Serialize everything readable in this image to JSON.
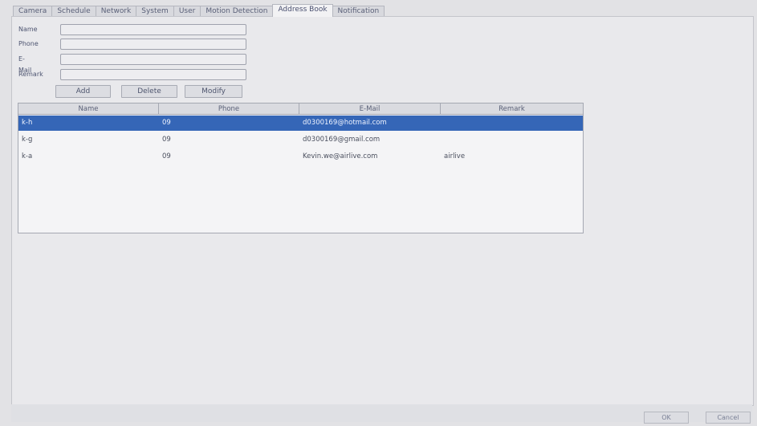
{
  "tabs": [
    "Camera",
    "Schedule",
    "Network",
    "System",
    "User",
    "Motion Detection",
    "Address Book",
    "Notification"
  ],
  "active_tab": "Address Book",
  "form": {
    "name_label": "Name",
    "phone_label": "Phone",
    "email_label": "E-Mail",
    "remark_label": "Remark",
    "name_value": "",
    "phone_value": "",
    "email_value": "",
    "remark_value": ""
  },
  "buttons": {
    "add": "Add",
    "delete": "Delete",
    "modify": "Modify"
  },
  "table": {
    "columns": [
      "Name",
      "Phone",
      "E-Mail",
      "Remark"
    ],
    "rows": [
      {
        "name": "k-h",
        "phone": "09",
        "email": "d0300169@hotmail.com",
        "remark": "",
        "selected": true
      },
      {
        "name": "k-g",
        "phone": "09",
        "email": "d0300169@gmail.com",
        "remark": "",
        "selected": false
      },
      {
        "name": "k-a",
        "phone": "09",
        "email": "Kevin.we@airlive.com",
        "remark": "airlive",
        "selected": false
      }
    ]
  },
  "footer": {
    "ok": "OK",
    "cancel": "Cancel"
  },
  "colors": {
    "selection": "#3566b7",
    "background": "#e2e2e5"
  }
}
